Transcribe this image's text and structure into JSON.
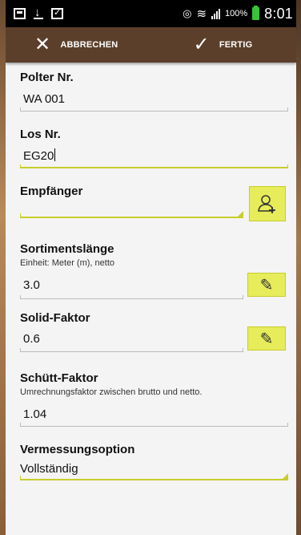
{
  "status_bar": {
    "battery_percent": "100%",
    "time": "8:01",
    "icons": [
      "gallery-icon",
      "download-icon",
      "check-icon",
      "eye-icon",
      "wifi-icon",
      "signal-icon",
      "battery-icon"
    ]
  },
  "action_bar": {
    "cancel_label": "ABBRECHEN",
    "done_label": "FERTIG"
  },
  "form": {
    "polter": {
      "label": "Polter Nr.",
      "value": "WA 001"
    },
    "los": {
      "label": "Los Nr.",
      "value": "EG20"
    },
    "empfaenger": {
      "label": "Empfänger",
      "value": ""
    },
    "sortimentslaenge": {
      "label": "Sortimentslänge",
      "sublabel": "Einheit: Meter (m), netto",
      "value": "3.0"
    },
    "solid": {
      "label": "Solid-Faktor",
      "value": "0.6"
    },
    "schuett": {
      "label": "Schütt-Faktor",
      "sublabel": "Umrechnungsfaktor zwischen brutto und netto.",
      "value": "1.04"
    },
    "vermessung": {
      "label": "Vermessungsoption",
      "value": "Vollständig"
    }
  },
  "colors": {
    "action_bar": "#5b3f2a",
    "accent": "#c8cd2a",
    "button_fill": "#e6ec5a",
    "battery": "#39c33a"
  }
}
